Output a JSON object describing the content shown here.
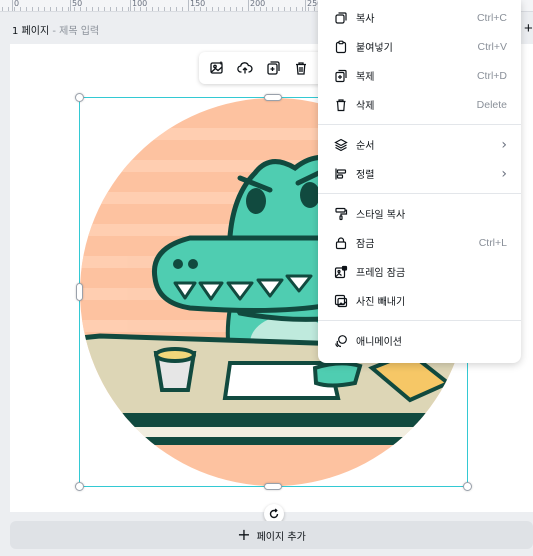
{
  "ruler": {
    "labels": [
      "0",
      "50",
      "100",
      "150",
      "200",
      "250"
    ]
  },
  "page_header": {
    "page_label": "1 페이지",
    "separator": "-",
    "title_placeholder": "제목 입력"
  },
  "toolbar": {
    "icons": [
      "image-edit-icon",
      "cloud-upload-icon",
      "duplicate-page-icon",
      "trash-icon"
    ]
  },
  "context_menu": {
    "groups": [
      [
        {
          "label": "복사",
          "shortcut": "Ctrl+C",
          "icon": "copy-icon"
        },
        {
          "label": "붙여넣기",
          "shortcut": "Ctrl+V",
          "icon": "paste-icon"
        },
        {
          "label": "복제",
          "shortcut": "Ctrl+D",
          "icon": "duplicate-icon"
        },
        {
          "label": "삭제",
          "shortcut": "Delete",
          "icon": "trash-icon"
        }
      ],
      [
        {
          "label": "순서",
          "submenu": true,
          "icon": "layers-icon"
        },
        {
          "label": "정렬",
          "submenu": true,
          "icon": "align-icon"
        }
      ],
      [
        {
          "label": "스타일 복사",
          "shortcut": "",
          "icon": "paint-roller-icon"
        },
        {
          "label": "잠금",
          "shortcut": "Ctrl+L",
          "icon": "lock-icon"
        },
        {
          "label": "프레임 잠금",
          "shortcut": "",
          "icon": "frame-lock-icon"
        },
        {
          "label": "사진 빼내기",
          "shortcut": "",
          "icon": "detach-image-icon"
        }
      ],
      [
        {
          "label": "애니메이션",
          "shortcut": "",
          "icon": "animation-icon"
        }
      ]
    ]
  },
  "add_page": {
    "label": "페이지 추가"
  },
  "colors": {
    "selection": "#33c9d3",
    "crocodile": "#4fcdb1",
    "background_circle": "#fdc2a0",
    "table": "#ddd6b6"
  }
}
